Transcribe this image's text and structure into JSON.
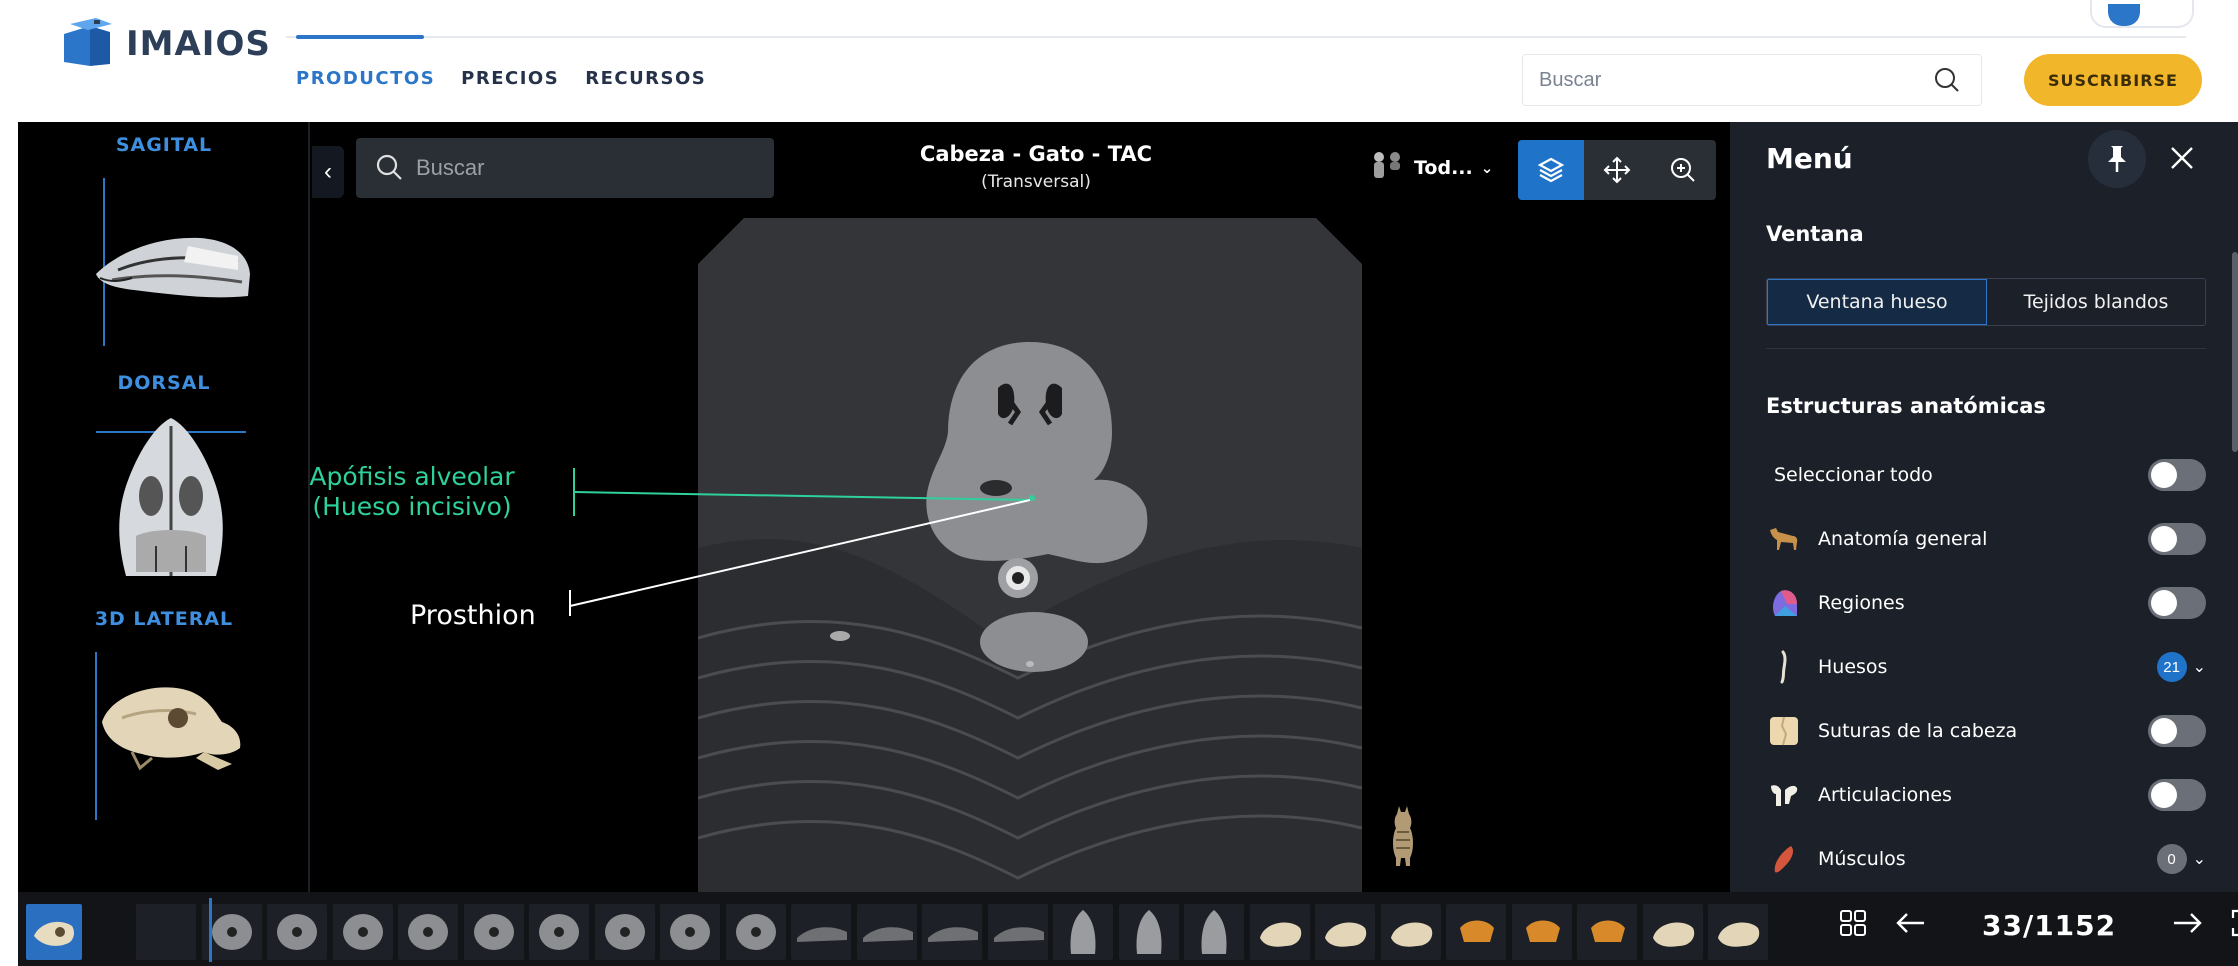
{
  "site": {
    "brand": "IMAIOS",
    "nav": [
      {
        "label": "PRODUCTOS",
        "active": true
      },
      {
        "label": "PRECIOS",
        "active": false
      },
      {
        "label": "RECURSOS",
        "active": false
      }
    ],
    "search_placeholder": "Buscar",
    "subscribe_label": "SUSCRIBIRSE",
    "accent_color": "#2b76c8",
    "subscribe_color": "#f1b62a"
  },
  "series": [
    {
      "label": "SAGITAL"
    },
    {
      "label": "DORSAL"
    },
    {
      "label": "3D LATERAL"
    }
  ],
  "viewer": {
    "search_placeholder": "Buscar",
    "title": "Cabeza - Gato - TAC",
    "subtitle": "(Transversal)",
    "species_label": "Tod...",
    "tools": [
      "layers-icon",
      "pan-icon",
      "zoom-icon"
    ],
    "annotations": [
      {
        "text_line1": "Apófisis alveolar",
        "text_line2": "(Hueso incisivo)",
        "color": "#2fd19b"
      },
      {
        "text": "Prosthion",
        "color": "#ffffff"
      }
    ]
  },
  "menu": {
    "title": "Menú",
    "window_section": "Ventana",
    "window_options": [
      {
        "label": "Ventana hueso",
        "selected": true
      },
      {
        "label": "Tejidos blandos",
        "selected": false
      }
    ],
    "structures_section": "Estructuras anatómicas",
    "items": [
      {
        "label": "Seleccionar todo",
        "icon": "",
        "control": "toggle"
      },
      {
        "label": "Anatomía general",
        "icon": "dog-icon",
        "control": "toggle"
      },
      {
        "label": "Regiones",
        "icon": "regions-icon",
        "control": "toggle"
      },
      {
        "label": "Huesos",
        "icon": "bone-icon",
        "control": "count",
        "count": "21",
        "badge_color": "#1f74c9"
      },
      {
        "label": "Suturas de la cabeza",
        "icon": "sutures-icon",
        "control": "toggle"
      },
      {
        "label": "Articulaciones",
        "icon": "joint-icon",
        "control": "toggle"
      },
      {
        "label": "Músculos",
        "icon": "muscle-icon",
        "control": "count",
        "count": "0",
        "badge_color": "#6b6f78"
      }
    ]
  },
  "pager": {
    "current": "33/1152"
  }
}
